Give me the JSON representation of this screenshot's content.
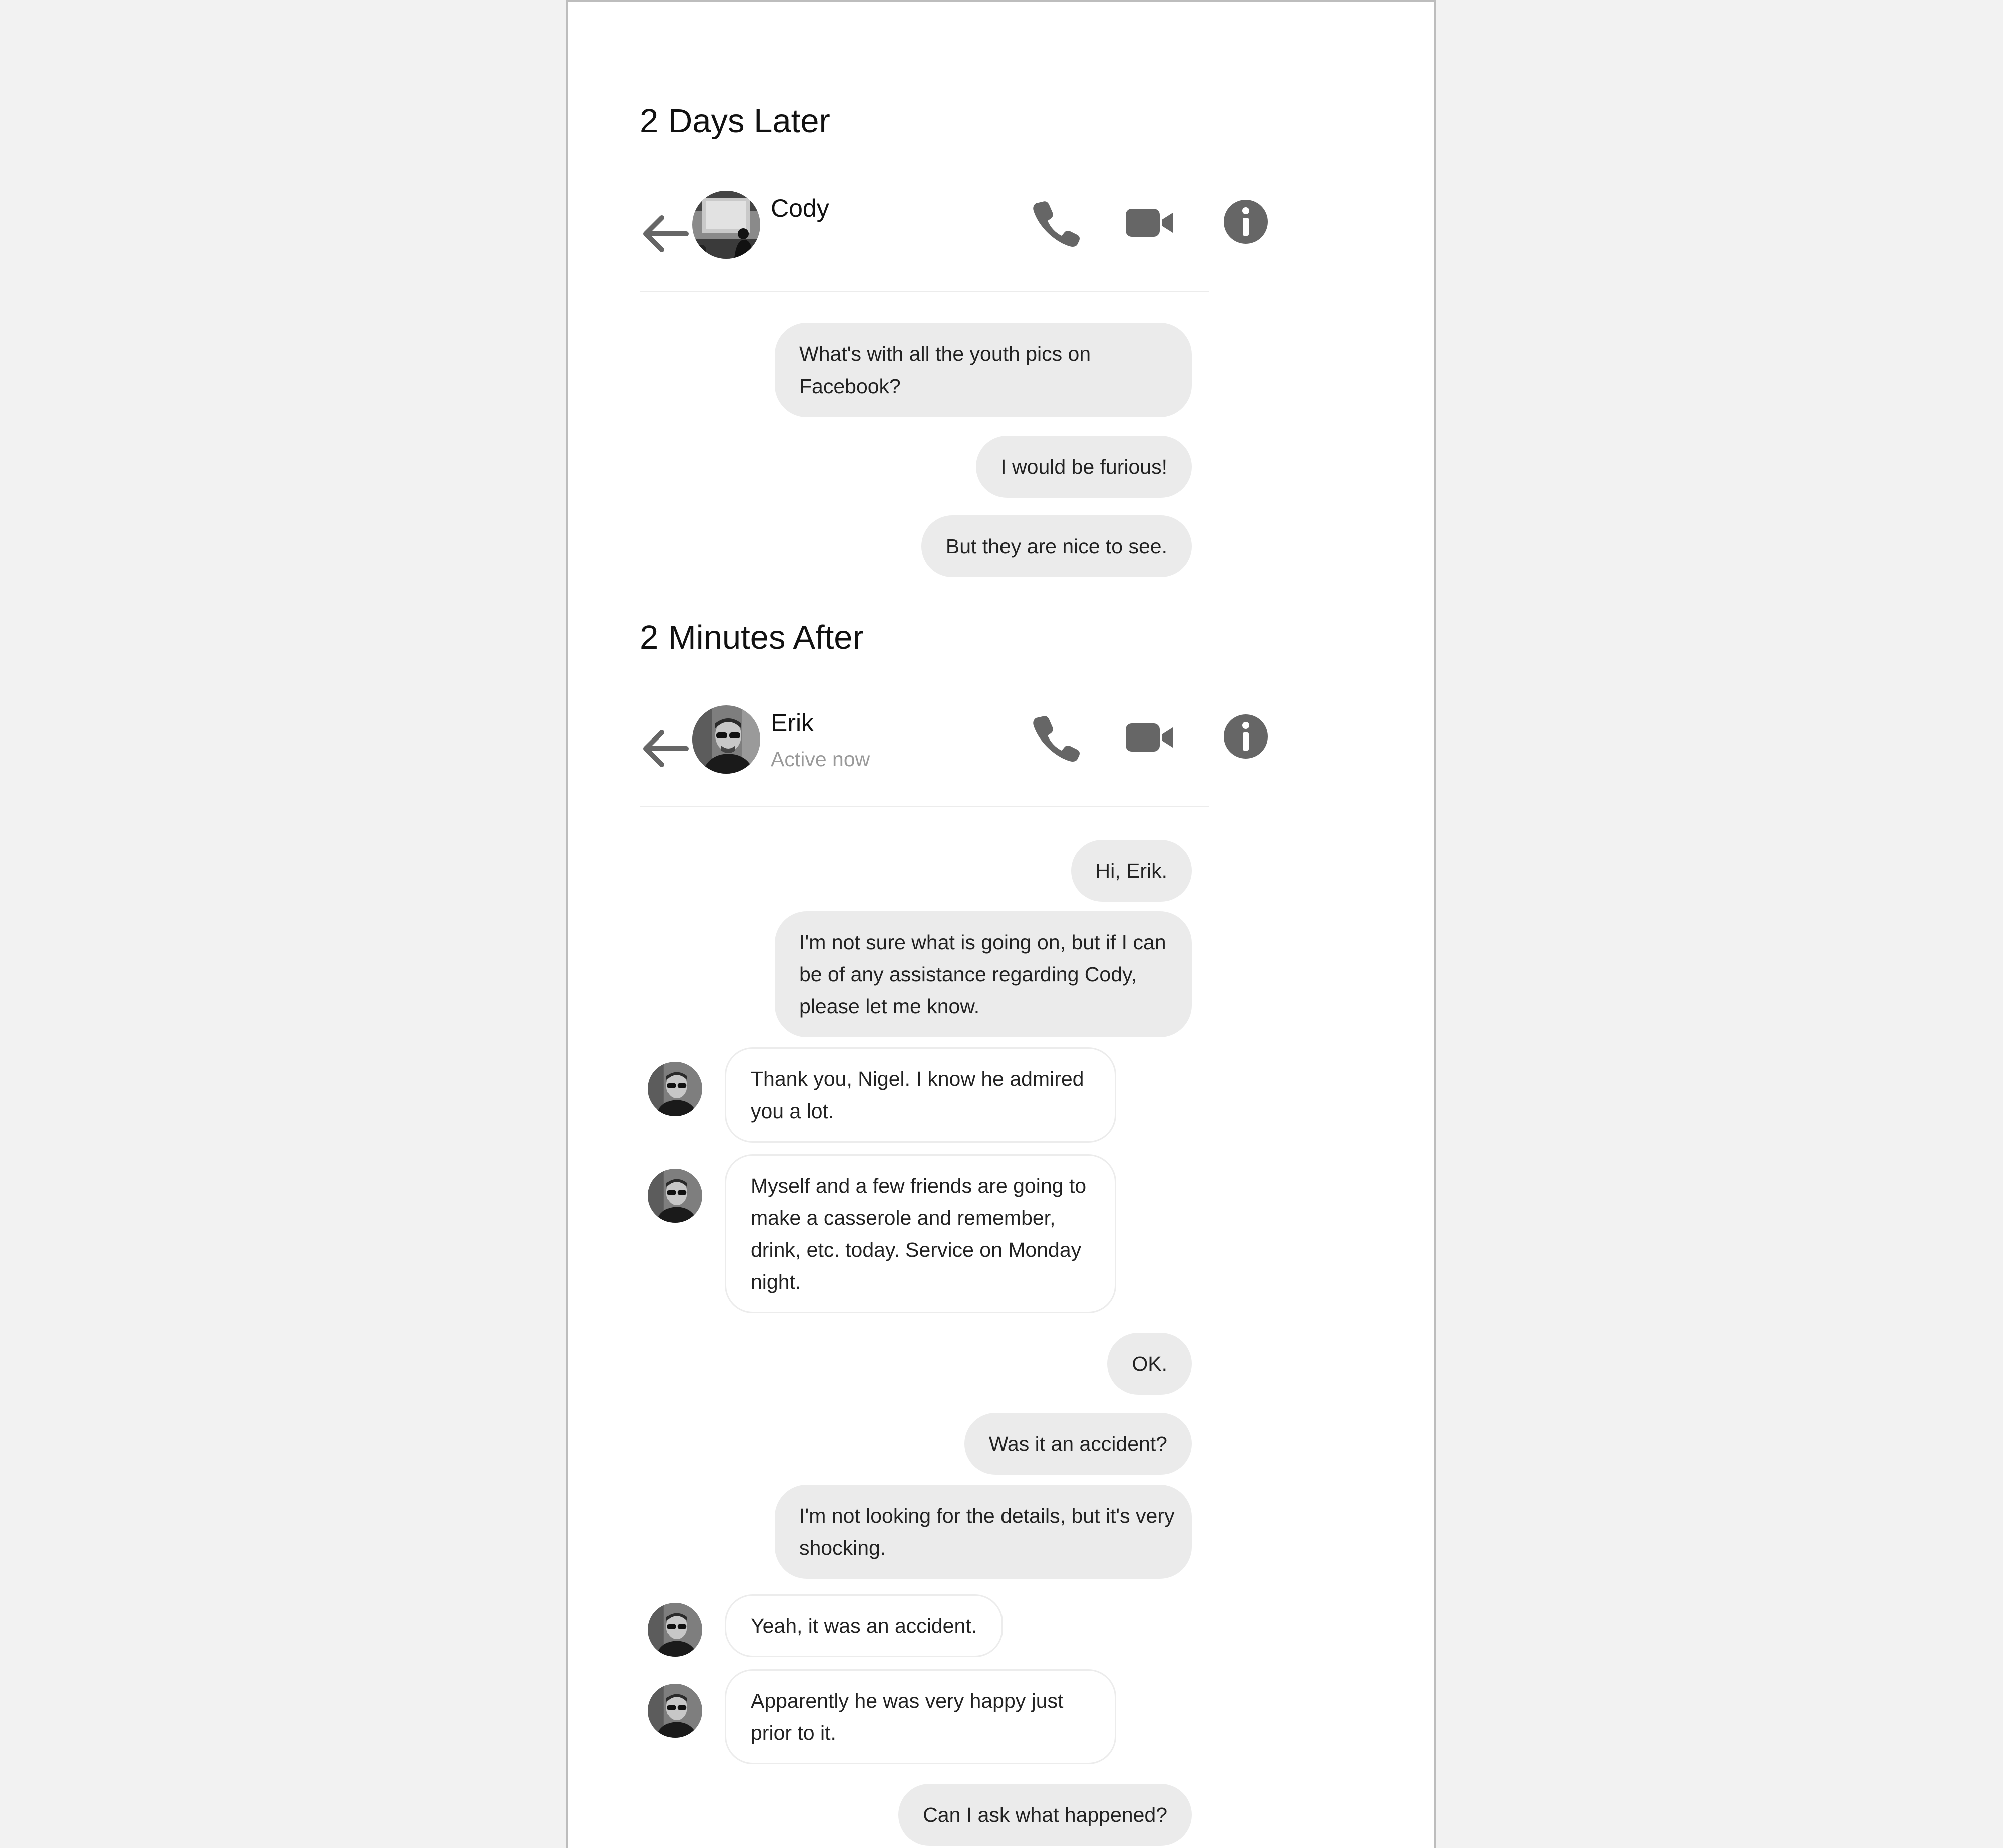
{
  "sections": [
    {
      "title": "2 Days Later",
      "contact": {
        "name": "Cody",
        "status": ""
      },
      "messages": [
        {
          "from": "me",
          "lines": [
            "What's with all the youth pics on",
            "Facebook?"
          ]
        },
        {
          "from": "me",
          "lines": [
            "I would be furious!"
          ]
        },
        {
          "from": "me",
          "lines": [
            "But they are nice to see."
          ]
        }
      ]
    },
    {
      "title": "2 Minutes After",
      "contact": {
        "name": "Erik",
        "status": "Active now"
      },
      "messages": [
        {
          "from": "me",
          "lines": [
            "Hi, Erik."
          ]
        },
        {
          "from": "me",
          "lines": [
            "I'm not sure what is going on, but if I can",
            "be of any assistance regarding Cody,",
            "please let me know."
          ]
        },
        {
          "from": "them",
          "lines": [
            "Thank you, Nigel. I know he admired",
            "you a lot."
          ]
        },
        {
          "from": "them",
          "lines": [
            "Myself and a few friends are going to",
            "make a casserole and remember,",
            "drink, etc. today. Service on Monday",
            "night."
          ]
        },
        {
          "from": "me",
          "lines": [
            "OK."
          ]
        },
        {
          "from": "me",
          "lines": [
            "Was it an accident?"
          ]
        },
        {
          "from": "me",
          "lines": [
            "I'm not looking for the details, but it's very",
            "shocking."
          ]
        },
        {
          "from": "them",
          "lines": [
            "Yeah, it was an accident."
          ]
        },
        {
          "from": "them",
          "lines": [
            "Apparently he was very happy just",
            "prior to it."
          ]
        },
        {
          "from": "me",
          "lines": [
            "Can I ask what happened?"
          ]
        }
      ]
    }
  ],
  "icons": {
    "back": "back-arrow-icon",
    "call": "phone-icon",
    "video": "video-camera-icon",
    "info": "info-icon"
  },
  "colors": {
    "icon": "#666666",
    "outgoing_bubble": "#ebebeb",
    "incoming_border": "#ececec",
    "status_text": "#9a9a9a"
  }
}
